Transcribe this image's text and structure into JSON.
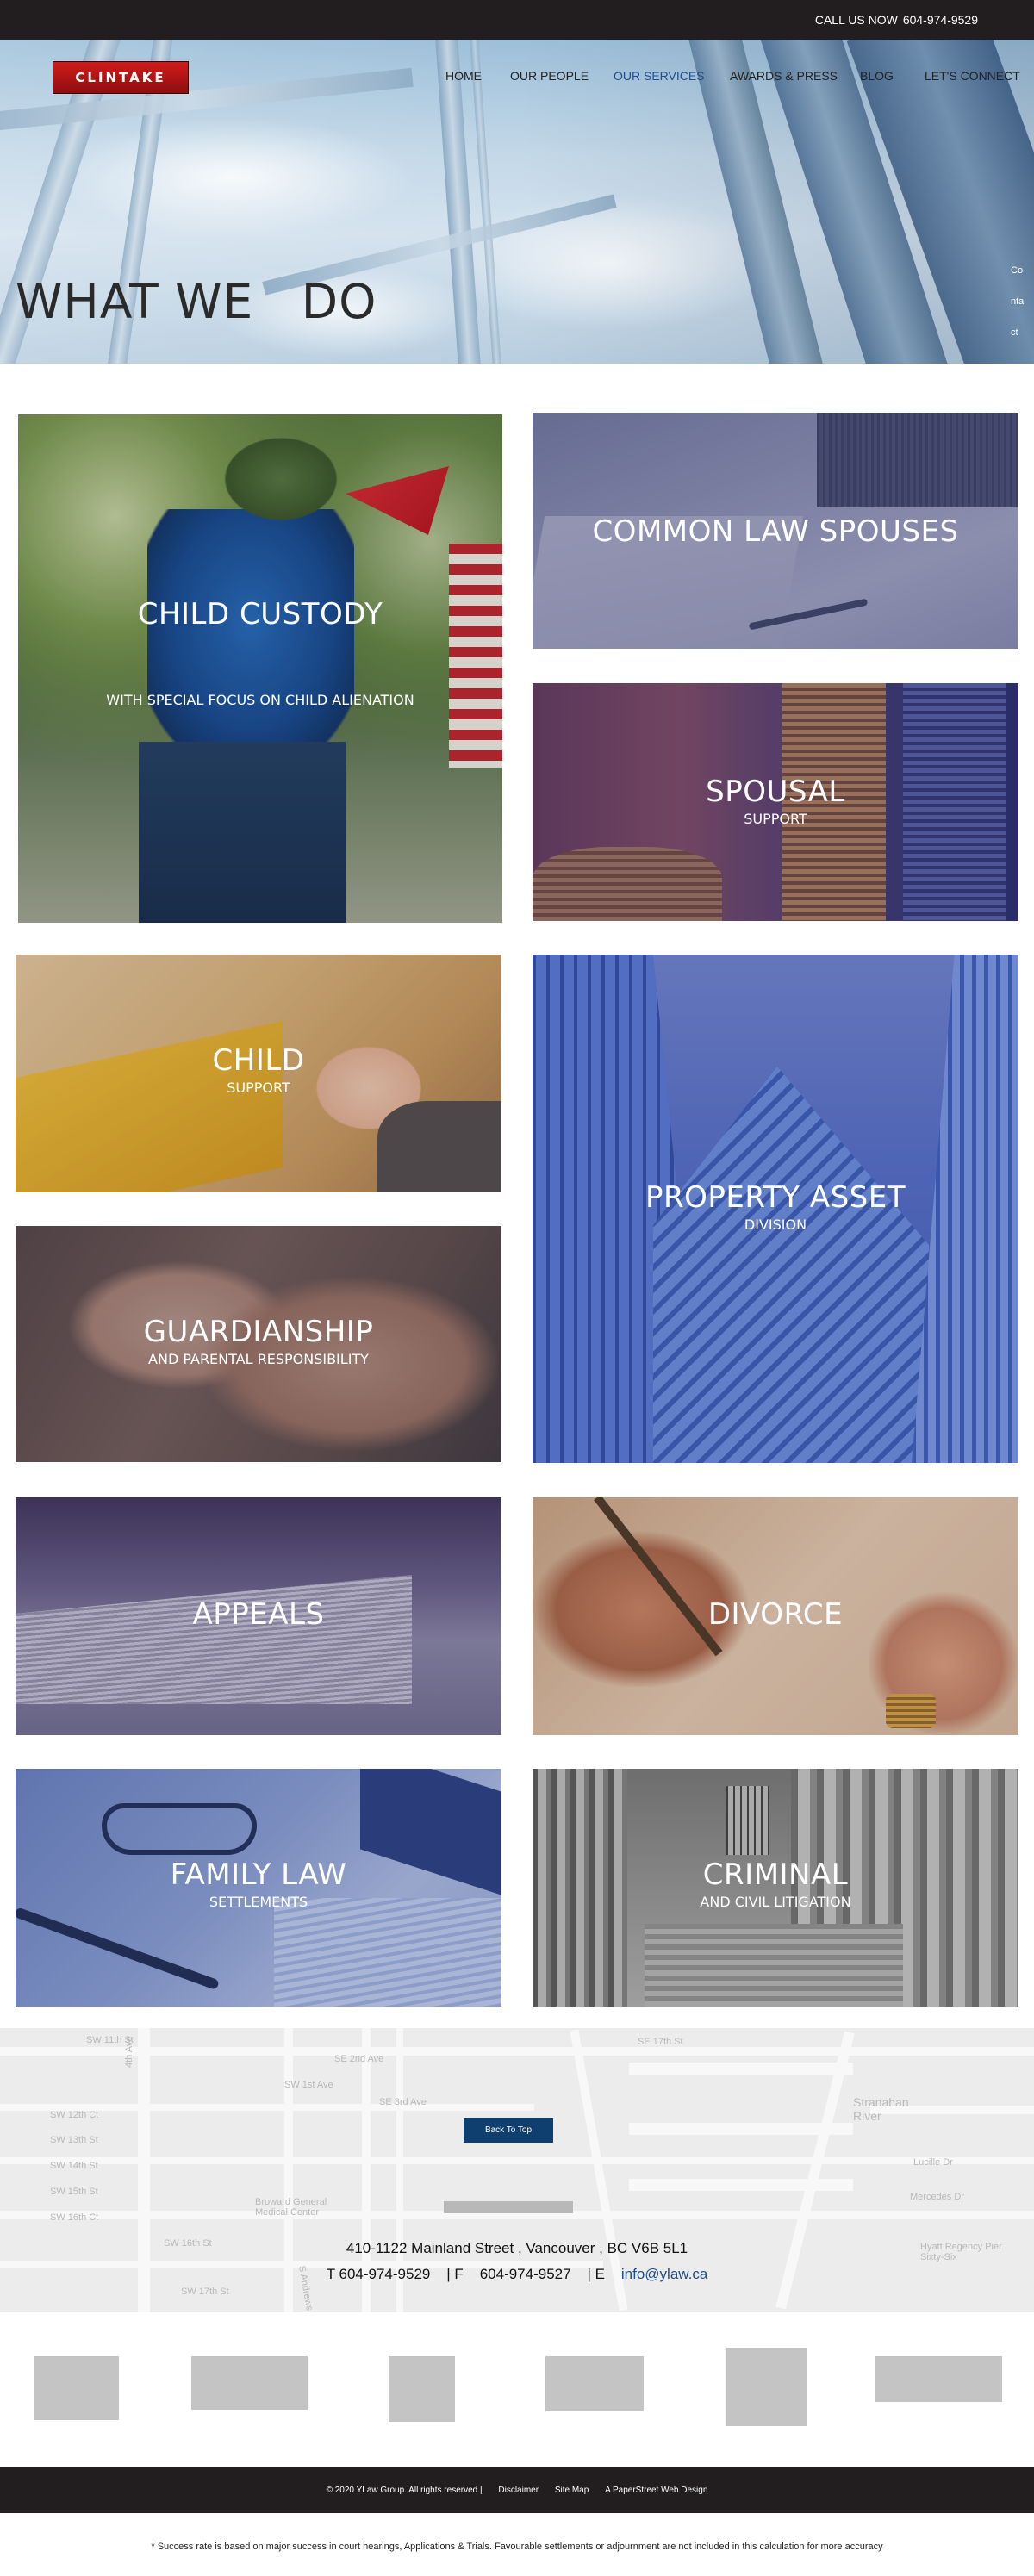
{
  "topbar": {
    "call_label": "CALL US NOW",
    "phone": "604-974-9529"
  },
  "header": {
    "logo": "CLINTAKE",
    "nav": [
      "HOME",
      "OUR PEOPLE",
      "OUR SERVICES",
      "AWARDS & PRESS",
      "BLOG",
      "LET'S CONNECT"
    ],
    "active_nav": "OUR SERVICES"
  },
  "hero": {
    "title": "WHAT WE   DO",
    "side_contact": [
      "Co",
      "nta",
      "ct"
    ]
  },
  "services": [
    {
      "title": "CHILD CUSTODY",
      "subtitle": "WITH SPECIAL FOCUS ON CHILD ALIENATION"
    },
    {
      "title": "COMMON LAW SPOUSES",
      "subtitle": ""
    },
    {
      "title": "SPOUSAL",
      "subtitle": "SUPPORT"
    },
    {
      "title": "CHILD",
      "subtitle": "SUPPORT"
    },
    {
      "title": "PROPERTY ASSET",
      "subtitle": "DIVISION"
    },
    {
      "title": "GUARDIANSHIP",
      "subtitle": "AND PARENTAL RESPONSIBILITY"
    },
    {
      "title": "APPEALS",
      "subtitle": ""
    },
    {
      "title": "DIVORCE",
      "subtitle": ""
    },
    {
      "title": "FAMILY LAW",
      "subtitle": "SETTLEMENTS"
    },
    {
      "title": "CRIMINAL",
      "subtitle": "AND CIVIL LITIGATION"
    }
  ],
  "contact": {
    "back_to_top": "Back To Top",
    "address": "410-1122 Mainland Street , Vancouver , BC  V6B 5L1",
    "phone_prefix": "T 604-974-9529",
    "fax_prefix": "| F",
    "fax": "604-974-9527",
    "email_prefix": "| E",
    "email": "info@ylaw.ca",
    "map_labels": [
      "SW 11th St",
      "SW 12th Ct",
      "SW 13th St",
      "SW 14th St",
      "SW 15th St",
      "SW 16th Ct",
      "SW 16th St",
      "SW 17th St",
      "4th Ave",
      "SW 1st Ave",
      "SE 2nd Ave",
      "SE 3rd Ave",
      "SE 17th St",
      "Broward General Medical Center",
      "Stranahan River",
      "Lucille Dr",
      "Mercedes Dr",
      "Hyatt Regency Pier Sixty-Six",
      "S Andrews"
    ]
  },
  "footer": {
    "copyright": "© 2020 YLaw Group. All rights reserved |",
    "links": [
      "Disclaimer",
      "Site Map",
      "A PaperStreet Web Design"
    ],
    "note": "* Success rate is based on major success in court hearings, Applications & Trials. Favourable settlements or adjournment are not included in this calculation for more accuracy"
  }
}
